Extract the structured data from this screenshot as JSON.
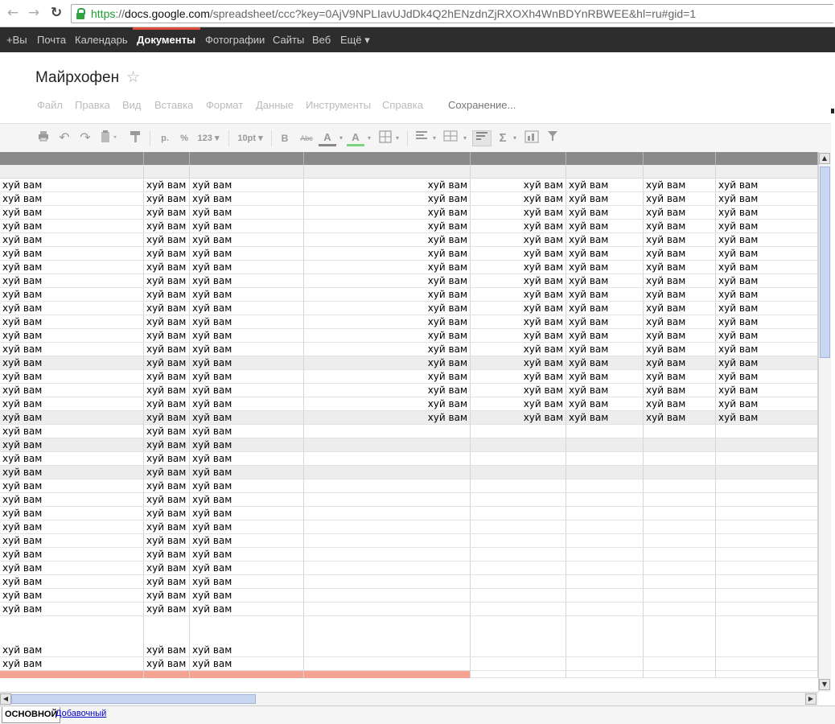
{
  "browser": {
    "url_scheme": "https",
    "url_host": "docs.google.com",
    "url_path": "/spreadsheet/ccc?key=0AjV9NPLIavUJdDk4Q2hENzdnZjRXOXh4WnBDYnRBWEE&hl=ru#gid=1",
    "back_icon": "back-arrow-icon",
    "forward_icon": "forward-arrow-icon",
    "reload_icon": "reload-icon"
  },
  "gbar": {
    "items": [
      "+Вы",
      "Почта",
      "Календарь",
      "Документы",
      "Фотографии",
      "Сайты",
      "Веб",
      "Ещё ▾"
    ],
    "active_index": 3
  },
  "doc": {
    "title": "Майрхофен",
    "star_icon": "☆",
    "menu": [
      "Файл",
      "Правка",
      "Вид",
      "Вставка",
      "Формат",
      "Данные",
      "Инструменты",
      "Справка"
    ],
    "status": "Сохранение..."
  },
  "toolbar": {
    "print_icon": "print-icon",
    "undo_icon": "undo-icon",
    "redo_icon": "redo-icon",
    "paste_icon": "paste-icon",
    "paint_format_icon": "paint-format-icon",
    "currency": "р.",
    "percent": "%",
    "number_format": "123 ▾",
    "font_size": "10pt ▾",
    "bold": "B",
    "strikethrough": "Abc",
    "text_color": "A",
    "fill_color": "A",
    "borders_icon": "borders-icon",
    "align_icon": "align-left-icon",
    "merge_icon": "merge-cells-icon",
    "wrap_icon": "wrap-text-icon",
    "sum": "Σ",
    "chart_icon": "chart-icon",
    "filter_icon": "filter-icon",
    "accent_red": "#dd4b39",
    "fill_green": "#7fd37f"
  },
  "sheet": {
    "cell_text": "хуй вам",
    "highlight_color": "#ededed",
    "salmon_color": "#f4a393"
  },
  "tabs": {
    "main": "ОСНОВНОЙ",
    "extra": "Добавочный"
  }
}
